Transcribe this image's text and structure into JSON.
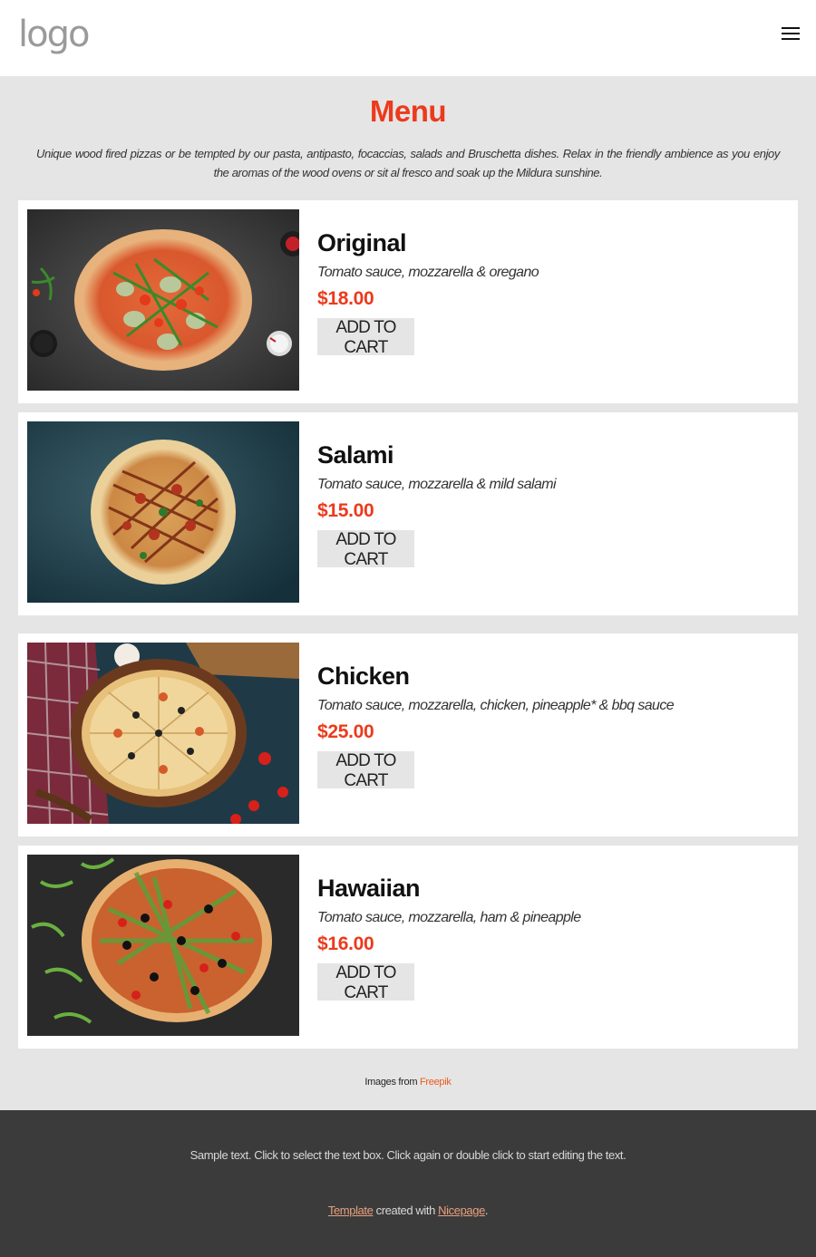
{
  "header": {
    "logo_text": "logo",
    "menu_icon": "hamburger-menu-icon"
  },
  "menu": {
    "title": "Menu",
    "intro": "Unique wood fired pizzas or be tempted by our pasta, antipasto, focaccias, salads and Bruschetta dishes. Relax in the friendly ambience as you enjoy the aromas of the wood ovens or sit al fresco and soak up the Mildura sunshine.",
    "items": [
      {
        "name": "Original",
        "description": "Tomato sauce, mozzarella & oregano",
        "price": "$18.00",
        "button": "ADD TO CART"
      },
      {
        "name": "Salami",
        "description": "Tomato sauce, mozzarella & mild salami",
        "price": "$15.00",
        "button": "ADD TO CART"
      },
      {
        "name": "Chicken",
        "description": "Tomato sauce, mozzarella, chicken, pineapple* & bbq sauce",
        "price": "$25.00",
        "button": "ADD TO CART"
      },
      {
        "name": "Hawaiian",
        "description": "Tomato sauce, mozzarella, ham & pineapple",
        "price": "$16.00",
        "button": "ADD TO CART"
      }
    ]
  },
  "credit": {
    "prefix": "Images from",
    "link": "Freepik"
  },
  "footer": {
    "sample_text": "Sample text. Click to select the text box. Click again or double click to start editing the text.",
    "template_link": "Template",
    "created_with": "created with",
    "nicepage_link": "Nicepage",
    "period": "."
  },
  "colors": {
    "accent": "#ec3a1c",
    "page_bg": "#e5e5e5",
    "footer_bg": "#3b3b3b",
    "footer_link": "#e8a07e"
  }
}
